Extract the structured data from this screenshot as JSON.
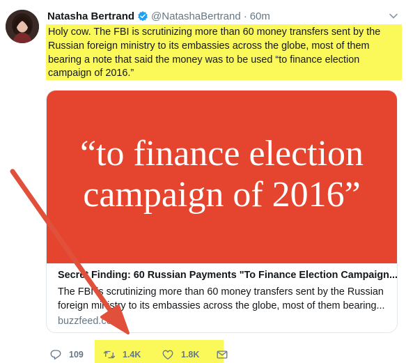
{
  "tweet": {
    "author_name": "Natasha Bertrand",
    "handle": "@NatashaBertrand",
    "separator": "·",
    "time": "60m",
    "text": "Holy cow. The FBI is scrutinizing more than 60 money transfers sent by the Russian foreign ministry to its embassies across the globe, most of them bearing a note that said the money was to be used “to finance election campaign of 2016.”"
  },
  "card": {
    "image_line_1": "“to finance election",
    "image_line_2": "campaign of 2016”",
    "image_bg": "#e5452e",
    "title": "Secret Finding: 60 Russian Payments \"To Finance Election Campaign...",
    "description": "The FBI is scrutinizing more than 60 money transfers sent by the Russian foreign ministry to its embassies across the globe, most of them bearing...",
    "domain": "buzzfeed.com"
  },
  "actions": {
    "reply_count": "109",
    "retweet_count": "1.4K",
    "like_count": "1.8K"
  },
  "icons": {
    "avatar": "avatar",
    "verified": "verified-badge-icon",
    "chevron": "chevron-down-icon",
    "reply": "reply-icon",
    "retweet": "retweet-icon",
    "like": "heart-icon",
    "dm": "envelope-icon"
  },
  "colors": {
    "highlight": "#fbf95a",
    "arrow": "#e0503a",
    "verified": "#1da1f2",
    "muted": "#657786"
  }
}
